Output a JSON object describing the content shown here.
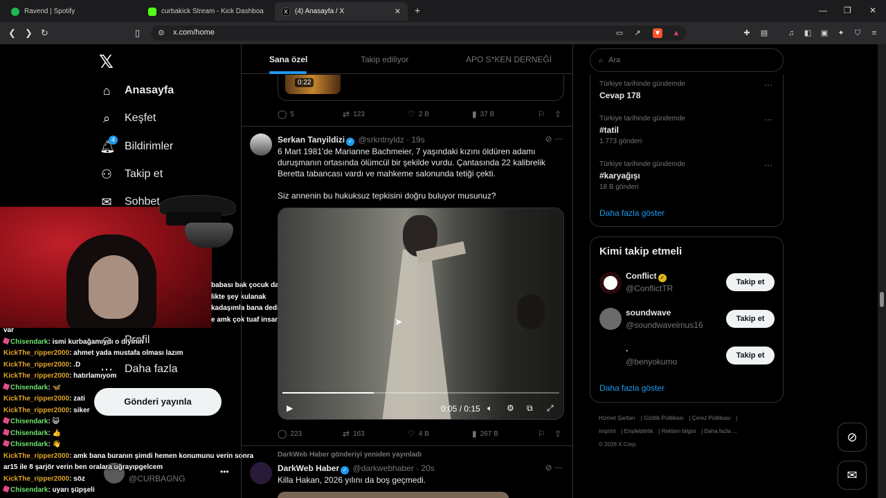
{
  "browser": {
    "tabs": [
      {
        "title": "Ravend | Spotify",
        "color": "#1db954"
      },
      {
        "title": "curbakick Stream - Kick Dashboa",
        "color": "#53fc18"
      },
      {
        "title": "(4) Anasayfa / X",
        "color": "#000000"
      }
    ],
    "url": "x.com/home",
    "new_tab": "+",
    "window": {
      "minimize": "—",
      "maximize": "❐",
      "close": "✕"
    }
  },
  "nav": {
    "logo": "𝕏",
    "items": [
      {
        "label": "Anasayfa",
        "icon": "home-icon"
      },
      {
        "label": "Keşfet",
        "icon": "search-icon"
      },
      {
        "label": "Bildirimler",
        "icon": "bell-icon",
        "badge": "4"
      },
      {
        "label": "Takip et",
        "icon": "person-add-icon"
      },
      {
        "label": "Sohbet",
        "icon": "mail-icon"
      },
      {
        "label": "Profil",
        "icon": "profile-icon"
      },
      {
        "label": "Daha fazla",
        "icon": "more-icon"
      }
    ],
    "post_button": "Gönderi yayınla",
    "account": {
      "handle": "@CURBAGNG",
      "more": "•••"
    }
  },
  "overlay": {
    "lines": [
      "babası bak çocuk daha",
      "likte şey kulanak",
      "kadaşımla bana dedik",
      "e amk çok tuaf insanlar"
    ]
  },
  "chat": [
    {
      "user": "",
      "msg": "var"
    },
    {
      "user": "Chisendark",
      "mod": true,
      "msg": "ismi kurbağamıydı o diyinin"
    },
    {
      "user": "KickThe_ripper2000",
      "mod": false,
      "msg": "ahmet yada mustafa olması lazım"
    },
    {
      "user": "KickThe_ripper2000",
      "mod": false,
      "msg": ".D"
    },
    {
      "user": "KickThe_ripper2000",
      "mod": false,
      "msg": "hatırlamıyom"
    },
    {
      "user": "Chisendark",
      "mod": true,
      "msg": "🦋"
    },
    {
      "user": "KickThe_ripper2000",
      "mod": false,
      "msg": "zati"
    },
    {
      "user": "KickThe_ripper2000",
      "mod": false,
      "msg": "siker"
    },
    {
      "user": "Chisendark",
      "mod": true,
      "msg": "😺"
    },
    {
      "user": "Chisendark",
      "mod": true,
      "msg": "👍"
    },
    {
      "user": "Chisendark",
      "mod": true,
      "msg": "👋"
    },
    {
      "user": "KickThe_ripper2000",
      "mod": false,
      "msg": "amk bana buranın şimdi hemen konumunu verin sonra"
    },
    {
      "user": "",
      "msg": "ar15 ile 8 şarjör verin ben oralara uğrayıpgelcem"
    },
    {
      "user": "KickThe_ripper2000",
      "mod": false,
      "msg": "söz"
    },
    {
      "user": "Chisendark",
      "mod": true,
      "msg": "uyarı şüpşeli"
    }
  ],
  "timeline": {
    "tabs": [
      "Sana özel",
      "Takip ediliyor",
      "APO S*KEN DERNEĞİ"
    ],
    "prev": {
      "duration": "0:22",
      "stats": {
        "replies": "5",
        "reposts": "123",
        "likes": "2 B",
        "views": "37 B"
      }
    },
    "tweet": {
      "name": "Serkan Tanyildizi",
      "handle": "@srkntnyldz · 19s",
      "text1": "6 Mart 1981'de Marianne Bachmeier, 7 yaşındaki kızını öldüren adamı duruşmanın ortasında ölümcül bir şekilde vurdu. Çantasında 22 kalibrelik Beretta tabancası vardı ve mahkeme salonunda tetiği çekti.",
      "text2": "Siz annenin bu hukuksuz tepkisini doğru buluyor musunuz?",
      "video_time": "0:05 / 0:15",
      "video_progress": 0.33,
      "stats": {
        "replies": "223",
        "reposts": "163",
        "likes": "4 B",
        "views": "267 B"
      }
    },
    "repost_label": "DarkWeb Haber gönderiyi yeniden yayınladı",
    "tweet2": {
      "name": "DarkWeb Haber",
      "handle": "@darkwebhaber · 20s",
      "text": "Killa Hakan, 2026 yılını da boş geçmedi."
    }
  },
  "right": {
    "search_placeholder": "Ara",
    "trends": [
      {
        "context": "Türkiye tarihinde gündemde",
        "name": "Cevap 178",
        "count": ""
      },
      {
        "context": "Türkiye tarihinde gündemde",
        "name": "#tatil",
        "count": "1.773 gönderi"
      },
      {
        "context": "Türkiye tarihinde gündemde",
        "name": "#karyağışı",
        "count": "18 B gönderi"
      }
    ],
    "show_more": "Daha fazla göster",
    "wtf_title": "Kimi takip etmeli",
    "who_to_follow": [
      {
        "name": "Conflict",
        "handle": "@ConflictTR",
        "button": "Takip et",
        "avatar": "#c0202a"
      },
      {
        "name": "soundwave",
        "handle": "@soundwaveimus16",
        "button": "Takip et",
        "avatar": "#6b6b6b"
      },
      {
        "name": ".",
        "handle": "@benyokumo",
        "button": "Takip et",
        "avatar": "#000000"
      }
    ],
    "show_more2": "Daha fazla göster",
    "footer": {
      "line1": [
        "Hizmet Şartları",
        "Gizlilik Politikası",
        "Çerez Politikası"
      ],
      "line2": [
        "Imprint",
        "Erişilebilirlik",
        "Reklam bilgisi",
        "Daha fazla ..."
      ],
      "copyright": "© 2026 X Corp."
    }
  }
}
